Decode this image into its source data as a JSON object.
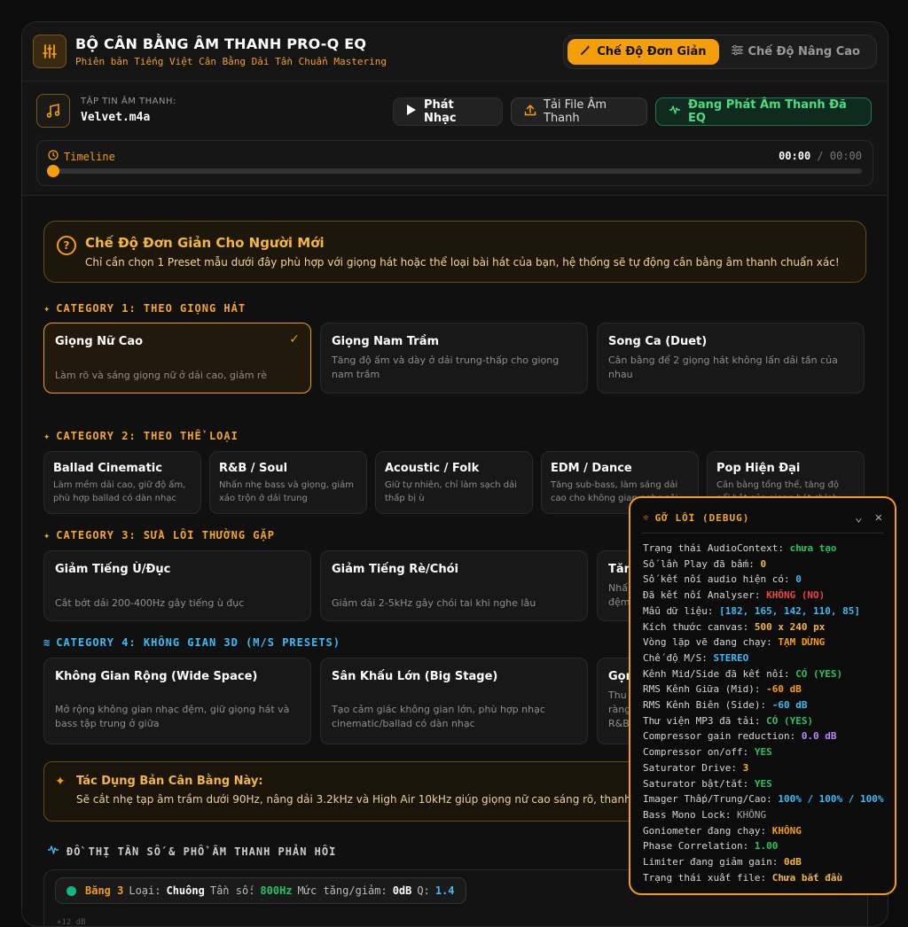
{
  "header": {
    "title": "BỘ CÂN BẰNG ÂM THANH PRO-Q EQ",
    "subtitle": "Phiên bản Tiếng Việt Cân Bằng Dải Tần Chuẩn Mastering",
    "mode_simple": "Chế Độ Đơn Giản",
    "mode_advanced": "Chế Độ Nâng Cao"
  },
  "player": {
    "file_label": "TẬP TIN ÂM THANH:",
    "file_name": "Velvet.m4a",
    "play": "Phát Nhạc",
    "upload": "Tải File Âm Thanh",
    "status": "Đang Phát Âm Thanh Đã EQ",
    "timeline_label": "Timeline",
    "current_time": "00:00",
    "sep": " / ",
    "total_time": "00:00",
    "progress": 0
  },
  "info": {
    "title": "Chế Độ Đơn Giản Cho Người Mới",
    "desc": "Chỉ cần chọn 1 Preset mẫu dưới đây phù hợp với giọng hát hoặc thể loại bài hát của bạn, hệ thống sẽ tự động cân bằng âm thanh chuẩn xác!"
  },
  "categories": {
    "c1": "CATEGORY 1: THEO GIỌNG HÁT",
    "c2": "CATEGORY 2: THEO THỂ LOẠI",
    "c3": "CATEGORY 3: SỬA LỖI THƯỜNG GẶP",
    "c4": "CATEGORY 4: KHÔNG GIAN 3D (M/S PRESETS)"
  },
  "cat1": [
    {
      "title": "Giọng Nữ Cao",
      "desc": "Làm rõ và sáng giọng nữ ở dải cao, giảm rè"
    },
    {
      "title": "Giọng Nam Trầm",
      "desc": "Tăng độ ấm và dày ở dải trung-thấp cho giọng nam trầm"
    },
    {
      "title": "Song Ca (Duet)",
      "desc": "Cân bằng để 2 giọng hát không lấn dải tần của nhau"
    }
  ],
  "cat2": [
    {
      "title": "Ballad Cinematic",
      "desc": "Làm mềm dải cao, giữ độ ấm, phù hợp ballad có dàn nhạc"
    },
    {
      "title": "R&B / Soul",
      "desc": "Nhấn nhẹ bass và giọng, giảm xáo trộn ở dải trung"
    },
    {
      "title": "Acoustic / Folk",
      "desc": "Giữ tự nhiên, chỉ làm sạch dải thấp bị ù"
    },
    {
      "title": "EDM / Dance",
      "desc": "Tăng sub-bass, làm sáng dải cao cho không gian nghe sôi..."
    },
    {
      "title": "Pop Hiện Đại",
      "desc": "Cân bằng tổng thể, tăng độ nổi bật của giọng hát chính"
    }
  ],
  "cat3": [
    {
      "title": "Giảm Tiếng Ù/Đục",
      "desc": "Cắt bớt dải 200-400Hz gây tiếng ù đục"
    },
    {
      "title": "Giảm Tiếng Rè/Chói",
      "desc": "Giảm dải 2-5kHz gây chói tai khi nghe lâu"
    },
    {
      "title": "Tăn",
      "desc": "Nhấ đệm"
    }
  ],
  "cat4": [
    {
      "title": "Không Gian Rộng (Wide Space)",
      "desc": "Mở rộng không gian nhạc đệm, giữ giọng hát và bass tập trung ở giữa"
    },
    {
      "title": "Sân Khấu Lớn (Big Stage)",
      "desc": "Tạo cảm giác không gian lớn, phù hợp nhạc cinematic/ballad có dàn nhạc"
    },
    {
      "title": "Gọn",
      "desc": "Thu ràng R&B"
    }
  ],
  "effect": {
    "title": "Tác Dụng Bản Cân Bằng Này:",
    "desc": "Sẽ cắt nhẹ tạp âm trầm dưới 90Hz, nâng dải 3.2kHz và High Air 10kHz giúp giọng nữ cao sáng rõ, thanh"
  },
  "graph": {
    "title": "ĐỒ THỊ TẦN SỐ & PHỔ ÂM THANH PHẢN HỒI",
    "band_name": "Băng 3",
    "type_label": "Loại:",
    "type_value": "Chuông",
    "freq_label": "Tần số:",
    "freq_value": "800Hz",
    "gain_label": "Mức tăng/giảm:",
    "gain_value": "0dB",
    "q_label": "Q:",
    "q_value": "1.4",
    "axis_top": "+12 dB"
  },
  "debug": {
    "title": "GỠ LỖI (DEBUG)",
    "rows": [
      {
        "label": "Trạng thái AudioContext: ",
        "value": "chưa tạo"
      },
      {
        "label": "Số lần Play đã bấm: ",
        "value": "0"
      },
      {
        "label": "Số kết nối audio hiện có: ",
        "value": "0"
      },
      {
        "label": "Đã kết nối Analyser: ",
        "value": "KHÔNG (NO)"
      },
      {
        "label": "Mẫu dữ liệu: ",
        "value": "[182, 165, 142, 110, 85]"
      },
      {
        "label": "Kích thước canvas: ",
        "value": "500 x 240 px"
      },
      {
        "label": "Vòng lặp vẽ đang chạy: ",
        "value": "TẠM DỪNG"
      },
      {
        "label": "Chế độ M/S: ",
        "value": "STEREO"
      },
      {
        "label": "Kênh Mid/Side đã kết nối: ",
        "value": "CÓ (YES)"
      },
      {
        "label": "RMS Kênh Giữa (Mid): ",
        "value": "-60 dB"
      },
      {
        "label": "RMS Kênh Biên (Side): ",
        "value": "-60 dB"
      },
      {
        "label": "Thư viện MP3 đã tải: ",
        "value": "CÓ (YES)"
      },
      {
        "label": "Compressor gain reduction: ",
        "value": "0.0 dB"
      },
      {
        "label": "Compressor on/off: ",
        "value": "YES"
      },
      {
        "label": "Saturator Drive: ",
        "value": "3"
      },
      {
        "label": "Saturator bật/tắt: ",
        "value": "YES"
      },
      {
        "label": "Imager Thấp/Trung/Cao: ",
        "value": "100% / 100% / 100%"
      },
      {
        "label": "Bass Mono Lock: ",
        "value": "KHÔNG"
      },
      {
        "label": "Goniometer đang chạy: ",
        "value": "KHÔNG"
      },
      {
        "label": "Phase Correlation: ",
        "value": "1.00"
      },
      {
        "label": "Limiter đang giảm gain: ",
        "value": "0dB"
      },
      {
        "label": "Trạng thái xuất file: ",
        "value": "Chưa bắt đầu"
      }
    ]
  },
  "colors": {
    "accent": "#f59e0b",
    "success": "#22c55e",
    "danger": "#ef4444",
    "info": "#38bdf8"
  }
}
